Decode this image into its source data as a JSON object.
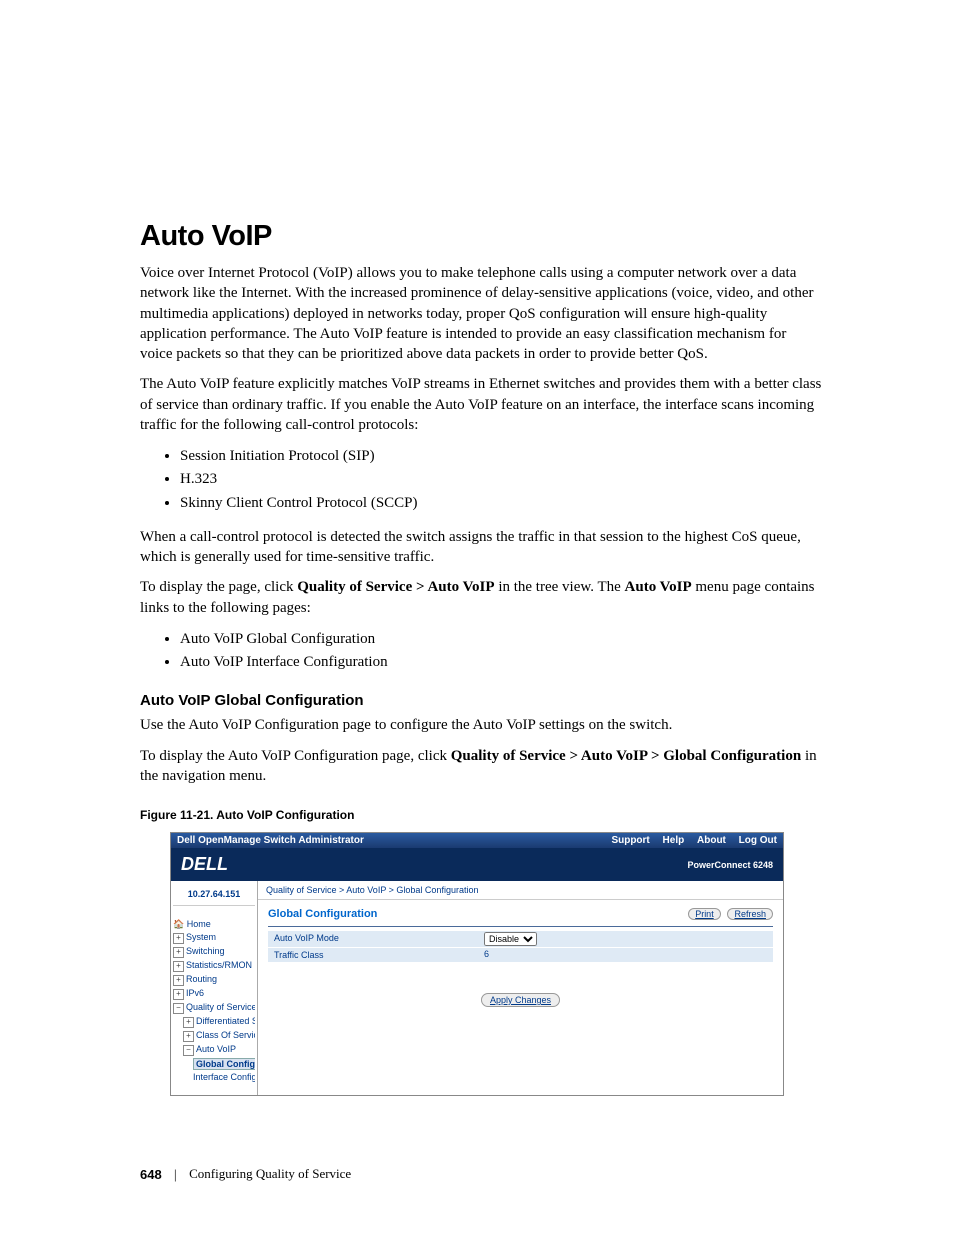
{
  "heading": "Auto VoIP",
  "para1": "Voice over Internet Protocol (VoIP) allows you to make telephone calls using a computer network over a data network like the Internet. With the increased prominence of delay-sensitive applications (voice, video, and other multimedia applications) deployed in networks today, proper QoS configuration will ensure high-quality application performance. The Auto VoIP feature is intended to provide an easy classification mechanism for voice packets so that they can be prioritized above data packets in order to provide better QoS.",
  "para2": "The Auto VoIP feature explicitly matches VoIP streams in Ethernet switches and provides them with a better class of service than ordinary traffic. If you enable the Auto VoIP feature on an interface, the interface scans incoming traffic for the following call-control protocols:",
  "protocols": [
    "Session Initiation Protocol (SIP)",
    "H.323",
    "Skinny Client Control Protocol (SCCP)"
  ],
  "para3": "When a call-control protocol is detected the switch assigns the traffic in that session to the highest CoS queue, which is generally used for time-sensitive traffic.",
  "para4_pre": "To display the page, click ",
  "para4_bold": "Quality of Service > Auto VoIP",
  "para4_mid": " in the tree view. The ",
  "para4_bold2": "Auto VoIP",
  "para4_post": " menu page contains links to the following pages:",
  "pages": [
    "Auto VoIP Global Configuration",
    "Auto VoIP Interface Configuration"
  ],
  "sub_heading": "Auto VoIP Global Configuration",
  "para5": "Use the Auto VoIP Configuration page to configure the Auto VoIP settings on the switch.",
  "para6_pre": "To display the Auto VoIP Configuration page, click ",
  "para6_bold": "Quality of Service > Auto VoIP > Global Configuration",
  "para6_post": " in the navigation menu.",
  "fig_caption": "Figure 11-21.    Auto VoIP Configuration",
  "app": {
    "title": "Dell OpenManage Switch Administrator",
    "links": {
      "support": "Support",
      "help": "Help",
      "about": "About",
      "logout": "Log Out"
    },
    "logo": "DELL",
    "model": "PowerConnect 6248",
    "ip": "10.27.64.151",
    "tree": {
      "home": "Home",
      "system": "System",
      "switching": "Switching",
      "stats": "Statistics/RMON",
      "routing": "Routing",
      "ipv6": "IPv6",
      "qos": "Quality of Service",
      "diff": "Differentiated Services",
      "cos": "Class Of Service",
      "autovoip": "Auto VoIP",
      "global": "Global Configuratio",
      "iface": "Interface Configura"
    },
    "breadcrumb": "Quality of Service > Auto VoIP > Global Configuration",
    "panel": {
      "title": "Global Configuration",
      "print": "Print",
      "refresh": "Refresh",
      "row1_label": "Auto VoIP Mode",
      "row1_value": "Disable",
      "row2_label": "Traffic Class",
      "row2_value": "6",
      "apply": "Apply Changes"
    }
  },
  "footer": {
    "page": "648",
    "section": "Configuring Quality of Service"
  }
}
